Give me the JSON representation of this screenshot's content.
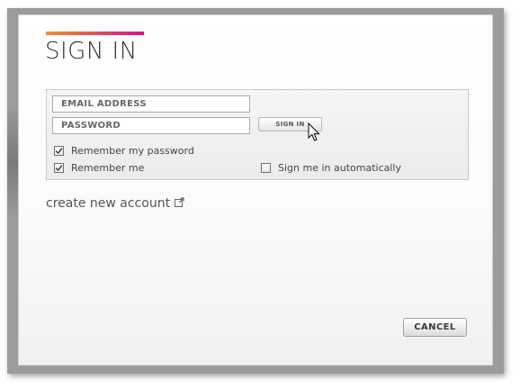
{
  "dialog": {
    "title": "SIGN IN",
    "accent_colors": [
      "#f0922e",
      "#e4406a",
      "#d4148f"
    ]
  },
  "form": {
    "email": {
      "placeholder": "EMAIL ADDRESS",
      "value": ""
    },
    "password": {
      "placeholder": "PASSWORD",
      "value": ""
    },
    "sign_in_label": "SIGN IN",
    "options": {
      "remember_password": {
        "label": "Remember my password",
        "checked": true
      },
      "remember_me": {
        "label": "Remember me",
        "checked": true
      },
      "auto_sign_in": {
        "label": "Sign me in automatically",
        "checked": false
      }
    }
  },
  "links": {
    "create_account": {
      "label": "create new account",
      "icon": "external-link-icon"
    }
  },
  "footer": {
    "cancel_label": "CANCEL"
  },
  "cursor": {
    "icon": "mouse-pointer-icon"
  }
}
